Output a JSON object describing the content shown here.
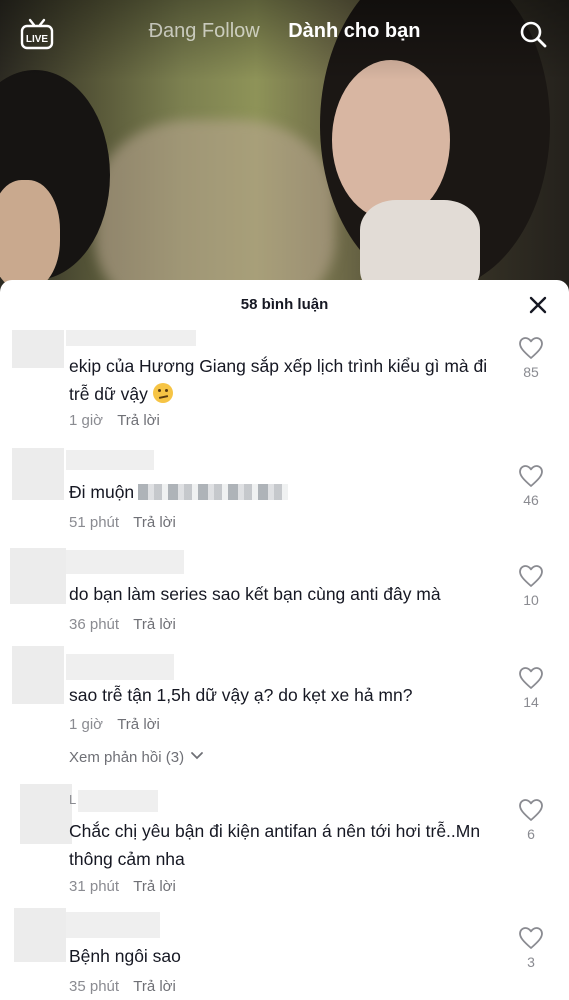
{
  "top_bar": {
    "tabs": [
      {
        "label": "Đang Follow",
        "active": false
      },
      {
        "label": "Dành cho bạn",
        "active": true
      }
    ]
  },
  "live_icon_label": "LIVE",
  "comments_sheet": {
    "title": "58 bình luận",
    "comments": [
      {
        "text": "ekip của Hương Giang sắp xếp lịch trình kiểu gì mà đi trễ dữ vậy",
        "emoji": "face-with-raised-eyebrow",
        "time": "1 giờ",
        "reply_label": "Trả lời",
        "likes": "85"
      },
      {
        "text": "Đi muộn",
        "time": "51 phút",
        "reply_label": "Trả lời",
        "likes": "46"
      },
      {
        "text": "do bạn làm series sao kết bạn cùng anti đây mà",
        "time": "36 phút",
        "reply_label": "Trả lời",
        "likes": "10"
      },
      {
        "text": "sao trễ tận 1,5h dữ vậy ạ? do kẹt xe hả mn?",
        "time": "1 giờ",
        "reply_label": "Trả lời",
        "likes": "14",
        "view_replies": "Xem phản hồi (3)"
      },
      {
        "username_initial": "L",
        "text": "Chắc chị yêu bận đi kiện antifan á nên tới hơi trễ..Mn thông cảm nha",
        "time": "31 phút",
        "reply_label": "Trả lời",
        "likes": "6"
      },
      {
        "text": "Bệnh ngôi sao",
        "time": "35 phút",
        "reply_label": "Trả lời",
        "likes": "3"
      }
    ]
  },
  "colors": {
    "text": "#161823",
    "muted": "#8a8b91",
    "sheet_bg": "#ffffff"
  },
  "icons": [
    "live-icon",
    "search-icon",
    "close-icon",
    "heart-icon",
    "chevron-down-icon"
  ]
}
